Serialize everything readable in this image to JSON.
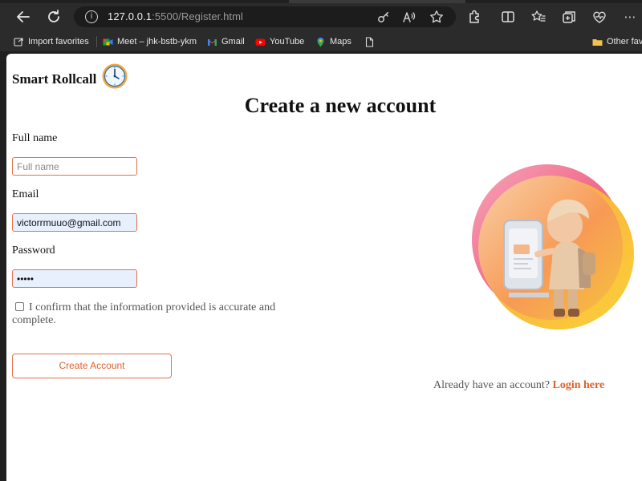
{
  "browser": {
    "url_host": "127.0.0.1",
    "url_rest": ":5500/Register.html",
    "bookmarks": [
      {
        "label": "Import favorites",
        "icon": "import-icon"
      },
      {
        "label": "Meet – jhk-bstb-ykm",
        "icon": "meet-icon"
      },
      {
        "label": "Gmail",
        "icon": "gmail-icon"
      },
      {
        "label": "YouTube",
        "icon": "youtube-icon"
      },
      {
        "label": "Maps",
        "icon": "maps-icon"
      },
      {
        "label": "",
        "icon": "document-icon"
      },
      {
        "label": "Other fav",
        "icon": "folder-icon"
      }
    ]
  },
  "page": {
    "brand": "Smart Rollcall",
    "title": "Create a new account",
    "form": {
      "fullname_label": "Full name",
      "fullname_placeholder": "Full name",
      "email_label": "Email",
      "email_value": "victorrmuuo@gmail.com",
      "password_label": "Password",
      "password_value": "•••••",
      "confirm_text": "I confirm that the information provided is accurate and complete.",
      "submit_label": "Create Account"
    },
    "login_prompt": "Already have an account?",
    "login_link": "Login here"
  },
  "colors": {
    "accent": "#e0602c",
    "field_border": "#e0744c",
    "autofill_bg": "#e8f0fe"
  }
}
